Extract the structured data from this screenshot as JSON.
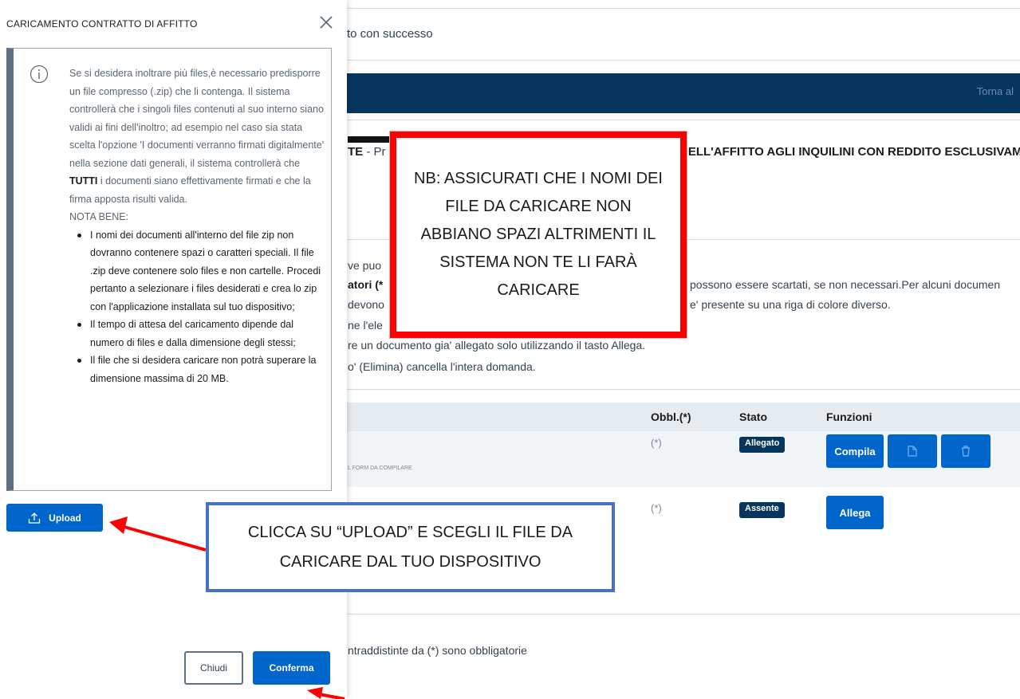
{
  "background": {
    "success_msg": "to con successo",
    "navbar_link": "Torna al",
    "title_left_prefix": "TE",
    "title_left_suffix": " - Pr",
    "title_right": "DELL'AFFITTO AGLI INQUILINI CON REDDITO ESCLUSIVAMEN",
    "line_ve_puo": "ve puo",
    "line_atori": "atori (*",
    "line_possono": "possono essere scartati, se non necessari.Per alcuni documen",
    "line_devono": "devono",
    "line_presente": "e' presente su una riga di colore diverso.",
    "line_ne_ele": "ne l'ele",
    "line_allega": "re un documento gia' allegato solo utilizzando il tasto Allega.",
    "line_elimina": "o' (Elimina) cancella l'intera domanda.",
    "table_headers": {
      "obbl": "Obbl.(*)",
      "stato": "Stato",
      "funzioni": "Funzioni"
    },
    "row1": {
      "obbl": "(*)",
      "badge": "Allegato",
      "btn_compila": "Compila",
      "small_text": "L FORM DA COMPILARE"
    },
    "row2": {
      "obbl": "(*)",
      "badge": "Assente",
      "btn_allega": "Allega"
    },
    "footer_note": "ntraddistinte da (*) sono obbligatorie"
  },
  "modal": {
    "title": "CARICAMENTO CONTRATTO DI AFFITTO",
    "info_p1_a": "Se si desidera inoltrare più files,è necessario predisporre un file compresso (.zip) che li contenga. Il sistema controllerà che i singoli files contenuti al suo interno siano validi ai fini dell'inoltro; ad esempio nel caso sia stata scelta l'opzione 'I documenti verranno firmati digitalmente' nella sezione dati generali, il sistema controllerà che ",
    "info_p1_bold": "TUTTI",
    "info_p1_b": " i documenti siano effettivamente firmati e che la firma apposta risulti valida.",
    "nota_bene": "NOTA BENE:",
    "list": [
      "I nomi dei documenti all'interno del file zip non dovranno contenere spazi o caratteri speciali. Il file .zip deve contenere solo files e non cartelle. Procedi pertanto a selezionare i files desiderati e crea lo zip con l'applicazione installata sul tuo dispositivo;",
      "Il tempo di attesa del caricamento dipende dal numero di files e dalla dimensione degli stessi;",
      "Il file che si desidera caricare non potrà superare la dimensione massima di 20 MB."
    ],
    "upload_label": "Upload",
    "chiudi_label": "Chiudi",
    "conferma_label": "Conferma"
  },
  "callouts": {
    "nb": "NB: ASSICURATI CHE I NOMI DEI FILE DA CARICARE NON ABBIANO SPAZI ALTRIMENTI IL SISTEMA NON TE LI FARÀ CARICARE",
    "upload": "CLICCA SU “UPLOAD” E SCEGLI IL FILE DA CARICARE DAL TUO DISPOSITIVO"
  },
  "colors": {
    "primary": "#0066cc",
    "navbar": "#06365e",
    "callout_red": "#ff0000",
    "callout_blue": "#4472c4"
  },
  "icons": {
    "close": "close-icon",
    "info": "info-icon",
    "upload": "upload-icon",
    "document": "document-icon",
    "trash": "trash-icon"
  }
}
